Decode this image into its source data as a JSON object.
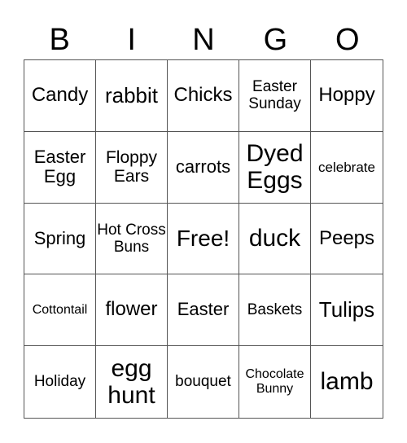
{
  "header": {
    "letters": [
      "B",
      "I",
      "N",
      "G",
      "O"
    ]
  },
  "cells": [
    "Candy",
    "rabbit",
    "Chicks",
    "Easter Sunday",
    "Hoppy",
    "Easter Egg",
    "Floppy Ears",
    "carrots",
    "Dyed Eggs",
    "celebrate",
    "Spring",
    "Hot Cross Buns",
    "Free!",
    "duck",
    "Peeps",
    "Cottontail",
    "flower",
    "Easter",
    "Baskets",
    "Tulips",
    "Holiday",
    "egg hunt",
    "bouquet",
    "Chocolate Bunny",
    "lamb"
  ]
}
